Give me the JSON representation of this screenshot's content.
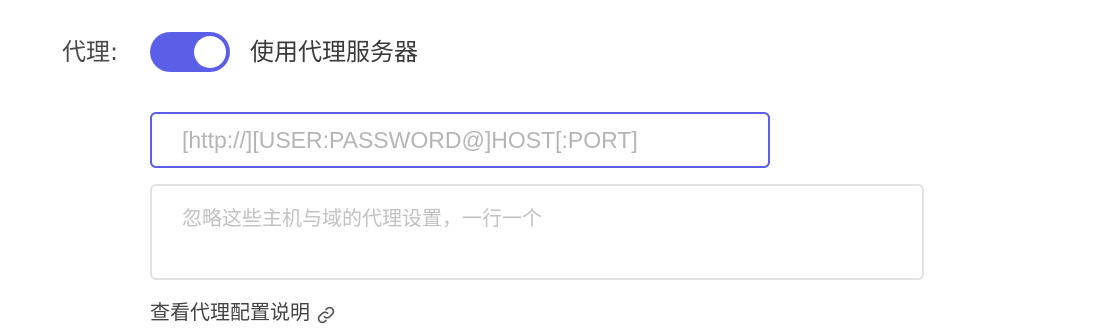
{
  "proxy": {
    "label": "代理:",
    "toggle_on": true,
    "toggle_label": "使用代理服务器",
    "accent_color": "#5b5fe8",
    "server_input": {
      "value": "",
      "placeholder": "[http://][USER:PASSWORD@]HOST[:PORT]"
    },
    "bypass_textarea": {
      "value": "",
      "placeholder": "忽略这些主机与域的代理设置，一行一个"
    },
    "help_link": {
      "label": "查看代理配置说明",
      "icon": "link-icon"
    }
  }
}
